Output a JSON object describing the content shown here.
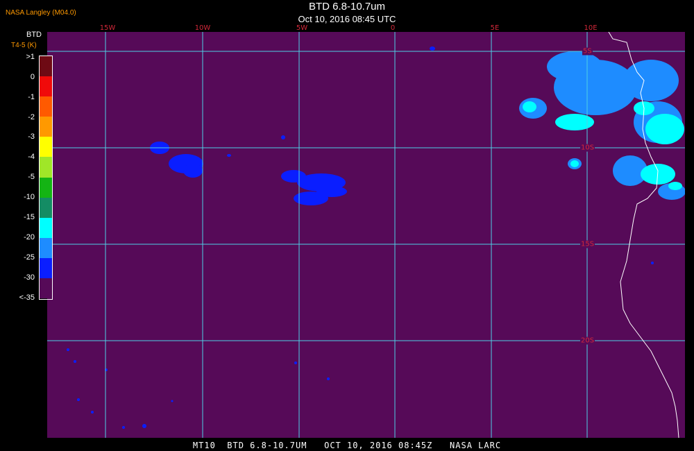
{
  "header": {
    "title": "BTD 6.8-10.7um",
    "subtitle": "Oct 10, 2016 08:45 UTC",
    "credit": "NASA Langley (M04.0)"
  },
  "legend": {
    "title": "BTD",
    "units": "T4-5 (K)",
    "labels": [
      ">1",
      "0",
      "-1",
      "-2",
      "-3",
      "-4",
      "-5",
      "-10",
      "-15",
      "-20",
      "-25",
      "-30",
      "<-35"
    ],
    "colors": [
      "#6e0a14",
      "#f00a0a",
      "#ff5a00",
      "#ff9900",
      "#ffff00",
      "#a0e628",
      "#14b414",
      "#148c64",
      "#00ffff",
      "#1e8cff",
      "#0a1eff",
      "#560a58"
    ]
  },
  "map": {
    "background_color": "#560a58",
    "grid_color": "#4fd0e6",
    "label_color": "#d3283a",
    "lon_labels": [
      "15W",
      "10W",
      "5W",
      "0",
      "5E",
      "10E"
    ],
    "lat_labels": [
      "5S",
      "10S",
      "15S",
      "20S"
    ]
  },
  "footer": {
    "text": "MT10  BTD 6.8-10.7UM   OCT 10, 2016 08:45Z   NASA LARC"
  }
}
